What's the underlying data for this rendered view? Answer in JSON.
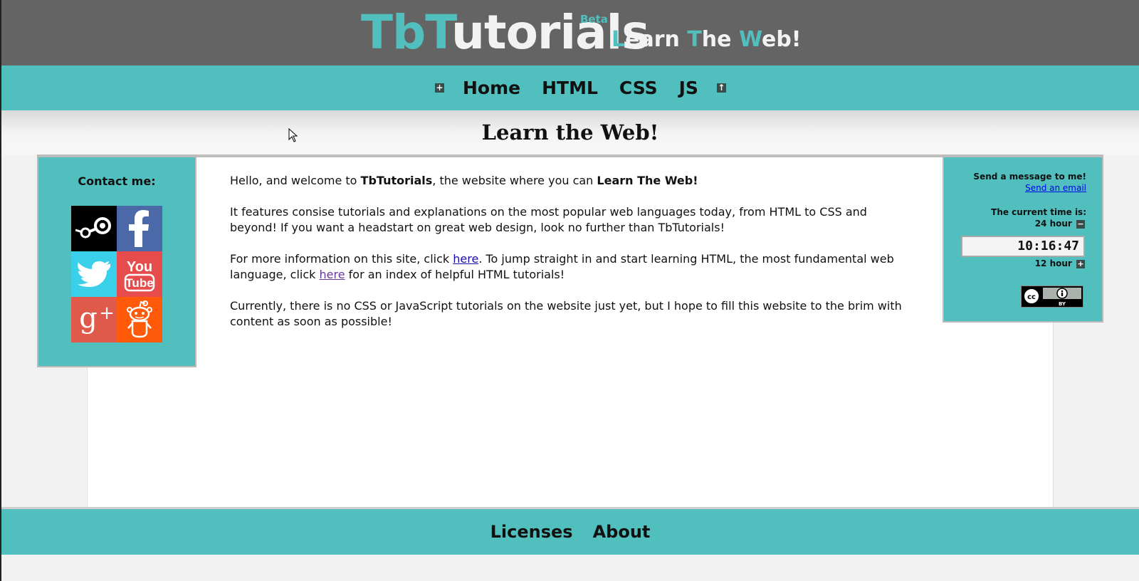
{
  "brand": {
    "title_part1": "Tb",
    "title_part2": "T",
    "title_part3": "utorials",
    "beta": "Beta",
    "tagline_l": "L",
    "tagline_earn": "earn ",
    "tagline_t": "T",
    "tagline_he": "he ",
    "tagline_w": "W",
    "tagline_eb": "eb!"
  },
  "nav": {
    "expand_icon": "+",
    "links": [
      "Home",
      "HTML",
      "CSS",
      "JS"
    ],
    "top_icon": "↑"
  },
  "page": {
    "title": "Learn the Web!"
  },
  "contact": {
    "title": "Contact me:",
    "networks": [
      "steam-icon",
      "facebook-icon",
      "twitter-icon",
      "youtube-icon",
      "google-plus-icon",
      "reddit-icon"
    ]
  },
  "main": {
    "p1_a": "Hello, and welcome to ",
    "p1_b": "TbTutorials",
    "p1_c": ", the website where you can ",
    "p1_d": "Learn The Web!",
    "p2": "It features consise tutorials and explanations on the most popular web languages today, from HTML to CSS and beyond! If you want a headstart on great web design, look no further than TbTutorials!",
    "p3_a": "For more information on this site, click ",
    "p3_link1": "here",
    "p3_b": ". To jump straight in and start learning HTML, the most fundamental web language, click ",
    "p3_link2": "here",
    "p3_c": " for an index of helpful HTML tutorials!",
    "p4": "Currently, there is no CSS or JavaScript tutorials on the website just yet, but I hope to fill this website to the brim with content as soon as possible!"
  },
  "side": {
    "message_label": "Send a message to me!",
    "email_link": "Send an email",
    "time_label": "The current time is:",
    "mode_24": "24 hour",
    "mode_24_btn": "−",
    "clock": "10:16:47",
    "mode_12": "12 hour",
    "mode_12_btn": "+",
    "license_badge": "BY"
  },
  "footer": {
    "links": [
      "Licenses",
      "About"
    ]
  },
  "colors": {
    "teal": "#52bfbf",
    "header": "#646464",
    "background": "#f2f2f2"
  }
}
